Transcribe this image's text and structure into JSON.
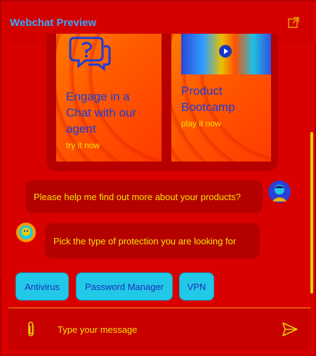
{
  "header": {
    "title": "Webchat Preview",
    "popout_icon": "external-link-icon"
  },
  "carousel": {
    "cards": [
      {
        "title": "Engage in a Chat with our agent",
        "link": "try it now",
        "icon": "chat-question-icon"
      },
      {
        "title": "Product Bootcamp",
        "link": "play it now",
        "image": "bootcamp-video-thumbnail"
      }
    ]
  },
  "messages": [
    {
      "from": "user",
      "text": "Please help me find out more about your products?"
    },
    {
      "from": "bot",
      "text": "Pick the type of protection you are looking for"
    }
  ],
  "suggestions": [
    "Antivirus",
    "Password Manager",
    "VPN"
  ],
  "composer": {
    "placeholder": "Type your message",
    "attach_icon": "paperclip-icon",
    "send_icon": "send-icon"
  },
  "colors": {
    "background": "#d90000",
    "header_title": "#3aa8ff",
    "text": "#f2e600",
    "chip_bg": "#22c8e8",
    "chip_text": "#1c2fb8",
    "card_title": "#1a3cd8",
    "scrollbar": "#e8d000"
  }
}
